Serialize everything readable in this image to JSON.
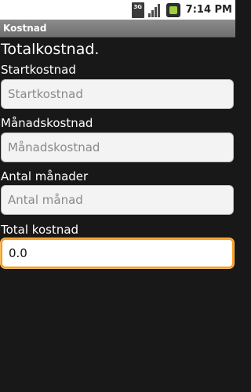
{
  "status_bar": {
    "network_label": "3G",
    "clock": "7:14 PM",
    "icons": [
      "3g-signal-icon",
      "signal-bars-icon",
      "battery-icon"
    ],
    "battery_color": "#9ed03a"
  },
  "title_bar": {
    "title": "Kostnad"
  },
  "form": {
    "heading": "Totalkostnad.",
    "fields": [
      {
        "label": "Startkostnad",
        "placeholder": "Startkostnad",
        "value": ""
      },
      {
        "label": "Månadskostnad",
        "placeholder": "Månadskostnad",
        "value": ""
      },
      {
        "label": "Antal månader",
        "placeholder": "Antal månad",
        "value": ""
      },
      {
        "label": "Total kostnad",
        "placeholder": "",
        "value": "0.0"
      }
    ],
    "focus_color": "#ff9b1e"
  }
}
